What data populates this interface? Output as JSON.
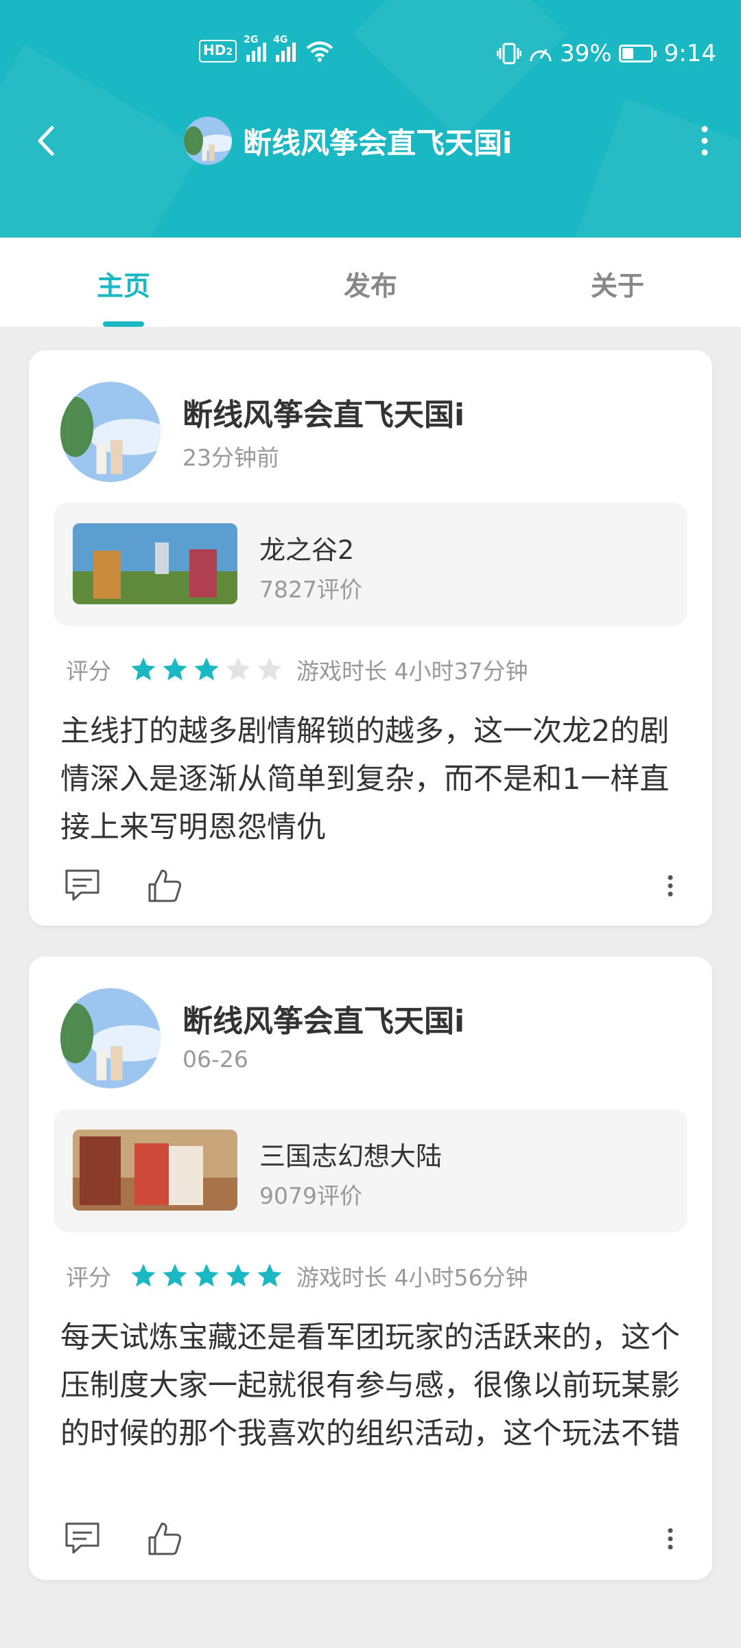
{
  "header": {
    "title": "断线风筝会直飞天国i",
    "accent_color": "#1ab8c2"
  },
  "status_bar": {
    "hd_badge": "HD",
    "hd_sub": "2",
    "sim1_label": "2G",
    "sim2_label": "4G",
    "battery_percent": "39%",
    "battery_level": 0.39,
    "time": "9:14"
  },
  "tabs": [
    {
      "label": "主页",
      "active": true
    },
    {
      "label": "发布",
      "active": false
    },
    {
      "label": "关于",
      "active": false
    }
  ],
  "posts": [
    {
      "username": "断线风筝会直飞天国i",
      "time": "23分钟前",
      "game_name": "龙之谷2",
      "game_reviews": "7827评价",
      "rating_label": "评分",
      "stars": 3,
      "playtime": "游戏时长 4小时37分钟",
      "body": "主线打的越多剧情解锁的越多，这一次龙2的剧情深入是逐渐从简单到复杂，而不是和1一样直接上来写明恩怨情仇"
    },
    {
      "username": "断线风筝会直飞天国i",
      "time": "06-26",
      "game_name": "三国志幻想大陆",
      "game_reviews": "9079评价",
      "rating_label": "评分",
      "stars": 5,
      "playtime": "游戏时长 4小时56分钟",
      "body": "每天试炼宝藏还是看军团玩家的活跃来的，这个压制度大家一起就很有参与感，很像以前玩某影的时候的那个我喜欢的组织活动，这个玩法不错"
    }
  ],
  "icons": [
    "back-arrow-icon",
    "more-vertical-icon",
    "comment-icon",
    "thumbs-up-icon",
    "star-icon",
    "wifi-icon",
    "vibrate-icon",
    "speed-icon",
    "battery-icon"
  ]
}
